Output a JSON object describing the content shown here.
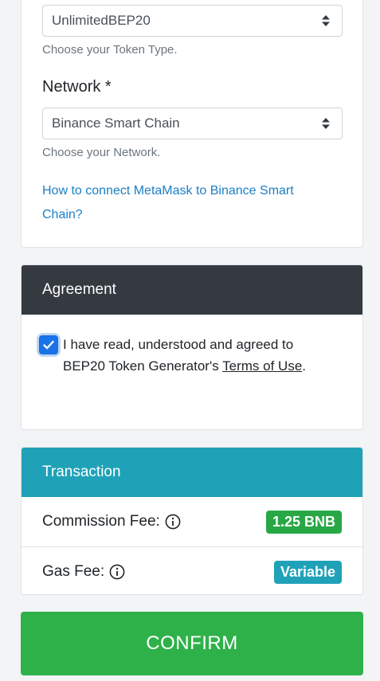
{
  "token_type": {
    "value": "UnlimitedBEP20",
    "help": "Choose your Token Type."
  },
  "network": {
    "label": "Network *",
    "value": "Binance Smart Chain",
    "help": "Choose your Network.",
    "link": "How to connect MetaMask to Binance Smart Chain?"
  },
  "agreement": {
    "title": "Agreement",
    "text_before": "I have read, understood and agreed to BEP20 Token Generator's ",
    "terms_link": "Terms of Use",
    "text_after": ".",
    "checked": true
  },
  "transaction": {
    "title": "Transaction",
    "commission_label": "Commission Fee:",
    "commission_value": "1.25 BNB",
    "gas_label": "Gas Fee:",
    "gas_value": "Variable"
  },
  "confirm_label": "CONFIRM",
  "colors": {
    "dark_header": "#343a40",
    "teal": "#1fa2b8",
    "green": "#28a745",
    "link": "#1a7fc4",
    "checkbox": "#1a73e8"
  },
  "icons": {
    "select_arrows": "sort-arrows-icon",
    "info": "info-circle-icon",
    "check": "check-icon"
  }
}
